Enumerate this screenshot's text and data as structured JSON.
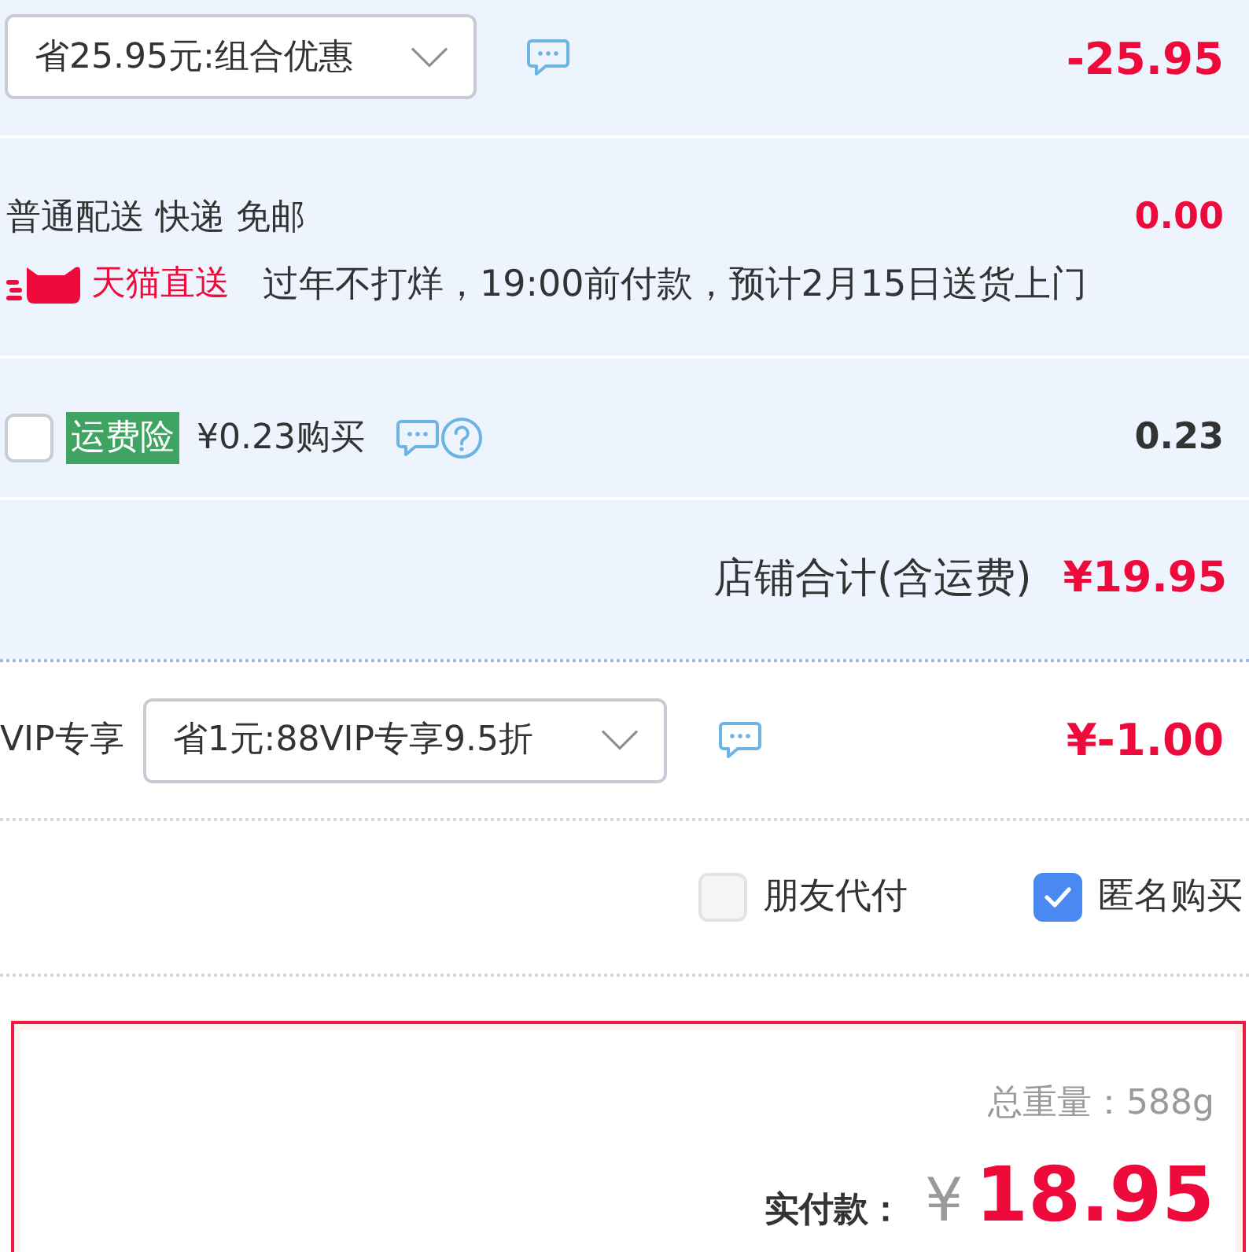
{
  "discount": {
    "option": "省25.95元:组合优惠",
    "amount": "-25.95"
  },
  "delivery": {
    "method": "普通配送 快递 免邮",
    "amount": "0.00",
    "badge": "天猫直送",
    "note": "过年不打烊，19:00前付款，预计2月15日送货上门"
  },
  "insurance": {
    "checked": false,
    "tag": "运费险",
    "label": "¥0.23购买",
    "amount": "0.23"
  },
  "store_total": {
    "label": "店铺合计(含运费)",
    "amount": "¥19.95"
  },
  "vip": {
    "label": "VIP专享",
    "option": "省1元:88VIP专享9.5折",
    "amount": "¥-1.00"
  },
  "options": [
    {
      "label": "朋友代付",
      "checked": false
    },
    {
      "label": "匿名购买",
      "checked": true
    }
  ],
  "summary": {
    "weight": "总重量：588g",
    "pay_label": "实付款：",
    "currency": "¥",
    "total": "18.95"
  }
}
